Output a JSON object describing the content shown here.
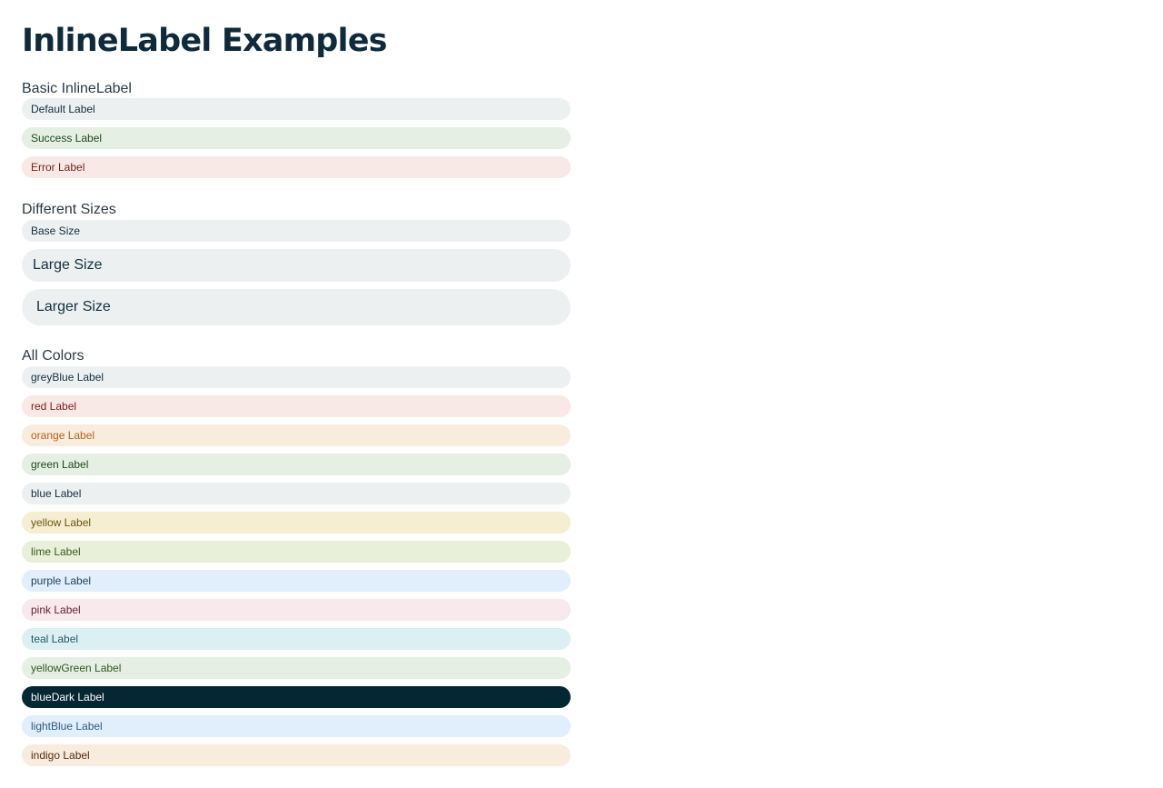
{
  "page": {
    "title": "InlineLabel Examples"
  },
  "sections": {
    "basic": {
      "heading": "Basic InlineLabel",
      "labels": [
        {
          "text": "Default Label",
          "bg": "#edf0f1",
          "fg": "#12303f"
        },
        {
          "text": "Success Label",
          "bg": "#e5efe3",
          "fg": "#1d4a1f"
        },
        {
          "text": "Error Label",
          "bg": "#f8e8e6",
          "fg": "#7a1f1a"
        }
      ]
    },
    "sizes": {
      "heading": "Different Sizes",
      "labels": [
        {
          "text": "Base Size",
          "bg": "#edf0f1",
          "fg": "#12303f"
        },
        {
          "text": "Large Size",
          "bg": "#edf0f1",
          "fg": "#12303f"
        },
        {
          "text": "Larger Size",
          "bg": "#edf0f1",
          "fg": "#12303f"
        }
      ]
    },
    "colors": {
      "heading": "All Colors",
      "labels": [
        {
          "text": "greyBlue Label",
          "bg": "#edf0f1",
          "fg": "#12303f"
        },
        {
          "text": "red Label",
          "bg": "#f8e8e6",
          "fg": "#7a1f1a"
        },
        {
          "text": "orange Label",
          "bg": "#f8ecde",
          "fg": "#b8621a"
        },
        {
          "text": "green Label",
          "bg": "#e5efe3",
          "fg": "#1d4a1f"
        },
        {
          "text": "blue Label",
          "bg": "#edf0f1",
          "fg": "#12303f"
        },
        {
          "text": "yellow Label",
          "bg": "#f5eed2",
          "fg": "#6e5410"
        },
        {
          "text": "lime Label",
          "bg": "#e8f0da",
          "fg": "#3f5a14"
        },
        {
          "text": "purple Label",
          "bg": "#e1eefb",
          "fg": "#1c3f5e"
        },
        {
          "text": "pink Label",
          "bg": "#f7e9ec",
          "fg": "#6a2236"
        },
        {
          "text": "teal Label",
          "bg": "#dcf0f4",
          "fg": "#1f5966"
        },
        {
          "text": "yellowGreen Label",
          "bg": "#e5efe3",
          "fg": "#2f5a1c"
        },
        {
          "text": "blueDark Label",
          "bg": "#052633",
          "fg": "#ffffff"
        },
        {
          "text": "lightBlue Label",
          "bg": "#e1eefb",
          "fg": "#2c5d83"
        },
        {
          "text": "indigo Label",
          "bg": "#f8ecde",
          "fg": "#5a2a10"
        }
      ]
    }
  }
}
